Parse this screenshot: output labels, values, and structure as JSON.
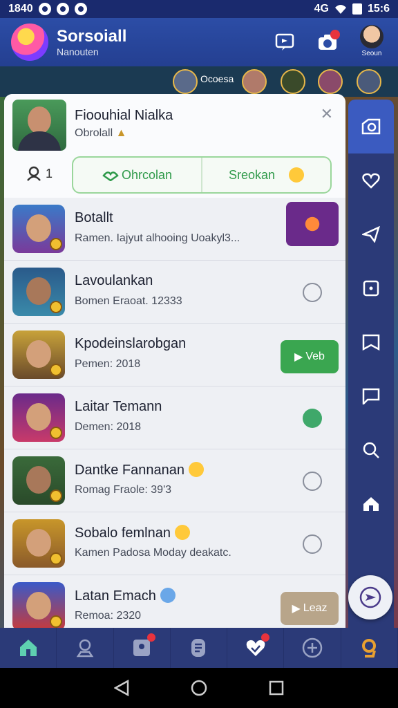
{
  "status_bar": {
    "time_left": "1840",
    "time_right": "15:6",
    "signal": "4G"
  },
  "header": {
    "title": "Sorsoiall",
    "subtitle": "Nanouten",
    "avatar_name": "Seoun"
  },
  "stories": {
    "label": "Ocoesa"
  },
  "profile": {
    "name": "Fioouhial Nialka",
    "status": "Obrolall",
    "count": "1",
    "segment_left": "Ohrcolan",
    "segment_right": "Sreokan"
  },
  "list": [
    {
      "title": "Botallt",
      "subtitle": "Ramen. Iajyut alhooing Uoakyl3..."
    },
    {
      "title": "Lavoulankan",
      "subtitle": "Bomen Eraoat. 12333"
    },
    {
      "title": "Kpodeinslarobgan",
      "subtitle": "Pemen: 2018",
      "action": "Veb"
    },
    {
      "title": "Laitar Temann",
      "subtitle": "Demen: 2018"
    },
    {
      "title": "Dantke Fannanan",
      "subtitle": "Romag Fraole: 39'3"
    },
    {
      "title": "Sobalo femlnan",
      "subtitle": "Kamen Padosa Moday deakatc."
    },
    {
      "title": "Latan Emach",
      "subtitle": "Remoa: 2320",
      "action": "Leaz"
    }
  ],
  "colors": {
    "accent": "#3aa650",
    "header": "#2c4da6",
    "rail": "#2b3a78"
  }
}
